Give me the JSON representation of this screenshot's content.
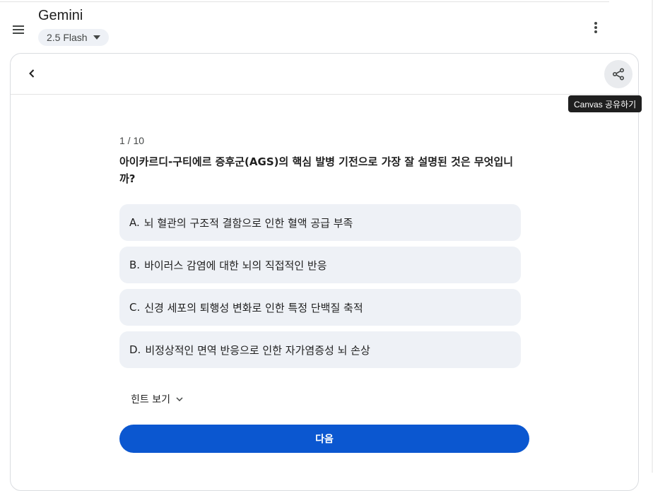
{
  "app": {
    "title": "Gemini",
    "model_label": "2.5 Flash"
  },
  "icons": {
    "menu": "menu-icon",
    "more": "more-vert-icon",
    "back": "chevron-left-icon",
    "share": "share-icon",
    "dropdown": "caret-down-icon",
    "hint_toggle": "chevron-down-icon"
  },
  "toolbar": {
    "share_tooltip": "Canvas 공유하기"
  },
  "quiz": {
    "progress": "1 / 10",
    "question": "아이카르디-구티에르 증후군(AGS)의 핵심 발병 기전으로 가장 잘 설명된 것은 무엇입니까?",
    "options": [
      {
        "letter": "A.",
        "text": "뇌 혈관의 구조적 결함으로 인한 혈액 공급 부족"
      },
      {
        "letter": "B.",
        "text": "바이러스 감염에 대한 뇌의 직접적인 반응"
      },
      {
        "letter": "C.",
        "text": "신경 세포의 퇴행성 변화로 인한 특정 단백질 축적"
      },
      {
        "letter": "D.",
        "text": "비정상적인 면역 반응으로 인한 자가염증성 뇌 손상"
      }
    ],
    "hint_label": "힌트 보기",
    "next_label": "다음"
  },
  "colors": {
    "primary_button": "#0b57d0",
    "option_bg": "#eef1f6",
    "tooltip_bg": "#1f1f1f"
  }
}
